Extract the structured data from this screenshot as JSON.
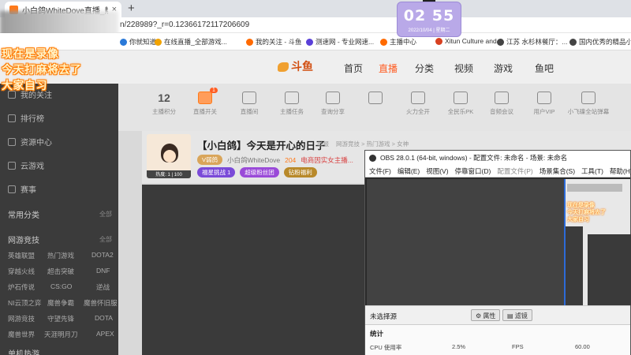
{
  "browser": {
    "tab_title": "小白鸽WhiteDove直播_热门游戏",
    "tab_close": "×",
    "new_tab": "+",
    "url": "n/228989?_r=0.12366172117206609",
    "bookmarks": [
      {
        "label": "你就知道",
        "color": "#2a79d8"
      },
      {
        "label": "在线直播_全部游戏...",
        "color": "#f2a300"
      },
      {
        "label": "我的关注 - 斗鱼",
        "color": "#ff6a00"
      },
      {
        "label": "测速网 - 专业网速...",
        "color": "#5a40d8"
      },
      {
        "label": "主播中心",
        "color": "#ff6a00"
      },
      {
        "label": "Xitun Culture and...",
        "color": "#d84020"
      },
      {
        "label": "江苏 水杉林餐厅：...",
        "color": "#444"
      },
      {
        "label": "国内优秀的精品小...",
        "color": "#444"
      }
    ]
  },
  "clock": {
    "time": "02 55",
    "date": "2022/10/04 | 星期二"
  },
  "overlay": {
    "line1": "现在是录像",
    "line2": "今天打麻将去了",
    "line3": "大家自习"
  },
  "site": {
    "logo": "斗鱼",
    "nav": [
      "首页",
      "直播",
      "分类",
      "视频",
      "游戏",
      "鱼吧"
    ],
    "nav_active_color": "#ff5d23"
  },
  "sidebar": {
    "items": [
      "我的关注",
      "排行榜",
      "资源中心",
      "云游戏",
      "赛事"
    ],
    "section_common": "常用分类",
    "section_games": "网游竞技",
    "more": "全部",
    "game_rows": [
      [
        "英雄联盟",
        "热门游戏",
        "DOTA2"
      ],
      [
        "穿越火线",
        "超击突破",
        "DNF"
      ],
      [
        "炉石传说",
        "CS:GO",
        "逆战"
      ],
      [
        "NI云顶之弈",
        "魔兽争霸",
        "魔兽怀旧服"
      ],
      [
        "网游竞技",
        "守望先锋",
        "DOTA"
      ],
      [
        "魔兽世界",
        "天涯明月刀",
        "APEX"
      ]
    ],
    "section_mobile": "单机热游"
  },
  "tools": [
    {
      "num": "12",
      "label": "主播积分"
    },
    {
      "label": "直播开关",
      "badge": "1"
    },
    {
      "label": "直播间"
    },
    {
      "label": "主播任务"
    },
    {
      "label": "查询分享"
    },
    {
      "label": ""
    },
    {
      "label": "火力全开"
    },
    {
      "label": "全民乐PK"
    },
    {
      "label": "音频会议"
    },
    {
      "label": "用户VIP"
    },
    {
      "label": "小飞碟全站弹幕"
    }
  ],
  "streamer": {
    "title": "【小白鸽】今天是开心的日子",
    "report": "举报",
    "category": "网游竞技 > 热门游戏 > 女神",
    "name": "小白鸽WhiteDove",
    "fans": "204",
    "notice": "电商因实女主播...",
    "level_tag": "V弱鸽",
    "pills": [
      {
        "label": "福星挑战",
        "count": "1",
        "color": "#7a4ad8"
      },
      {
        "label": "超级粉丝团",
        "color": "#9a4ad8"
      },
      {
        "label": "钻粉福利",
        "color": "#b8892a"
      }
    ],
    "avatar_tag": "热度: 1 | 100"
  },
  "obs": {
    "title": "OBS 28.0.1 (64-bit, windows) - 配置文件: 未命名 - 场景: 未命名",
    "menu": [
      "文件(F)",
      "编辑(E)",
      "视图(V)",
      "停靠窗口(D)",
      "配置文件(P)",
      "场景集合(S)",
      "工具(T)",
      "帮助(H)"
    ],
    "no_source": "未选择源",
    "btn_props": "属性",
    "btn_filters": "滤镜",
    "stats_header": "统计",
    "stats": [
      {
        "label": "CPU 使用率",
        "value": "2.5%"
      },
      {
        "label": "FPS",
        "value": "60.00"
      }
    ]
  }
}
